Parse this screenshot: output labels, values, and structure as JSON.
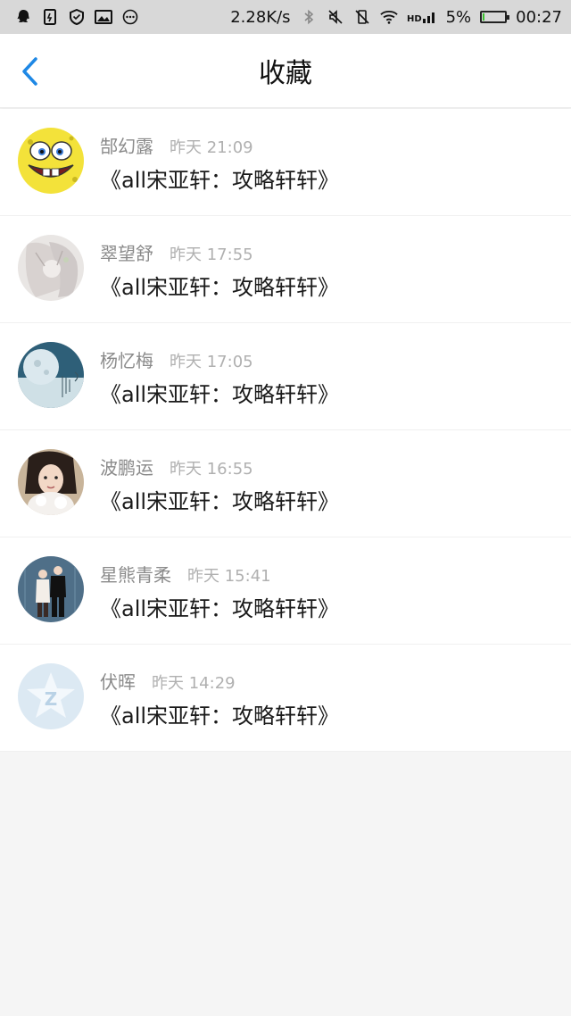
{
  "status_bar": {
    "speed": "2.28K/s",
    "battery_percent": "5%",
    "battery_level": 0.05,
    "time": "00:27",
    "left_icons": [
      "qq-icon",
      "sim-card-icon",
      "shield-icon",
      "image-icon",
      "more-dots-icon"
    ],
    "right_icons": [
      "bluetooth-icon",
      "mute-icon",
      "vibrate-off-icon",
      "wifi-icon",
      "hd-signal-icon"
    ]
  },
  "nav": {
    "title": "收藏",
    "back_icon": "chevron-left-icon",
    "accent_color": "#1e88e5"
  },
  "items": [
    {
      "name": "郜幻露",
      "time": "昨天 21:09",
      "title": "《all宋亚轩：攻略轩轩》",
      "avatar": "spongebob-avatar"
    },
    {
      "name": "翠望舒",
      "time": "昨天 17:55",
      "title": "《all宋亚轩：攻略轩轩》",
      "avatar": "anime-avatar"
    },
    {
      "name": "杨忆梅",
      "time": "昨天 17:05",
      "title": "《all宋亚轩：攻略轩轩》",
      "avatar": "moon-avatar"
    },
    {
      "name": "波鹏运",
      "time": "昨天 16:55",
      "title": "《all宋亚轩：攻略轩轩》",
      "avatar": "girl-avatar"
    },
    {
      "name": "星熊青柔",
      "time": "昨天 15:41",
      "title": "《all宋亚轩：攻略轩轩》",
      "avatar": "couple-avatar"
    },
    {
      "name": "伏晖",
      "time": "昨天 14:29",
      "title": "《all宋亚轩：攻略轩轩》",
      "avatar": "qzone-default-avatar"
    }
  ]
}
